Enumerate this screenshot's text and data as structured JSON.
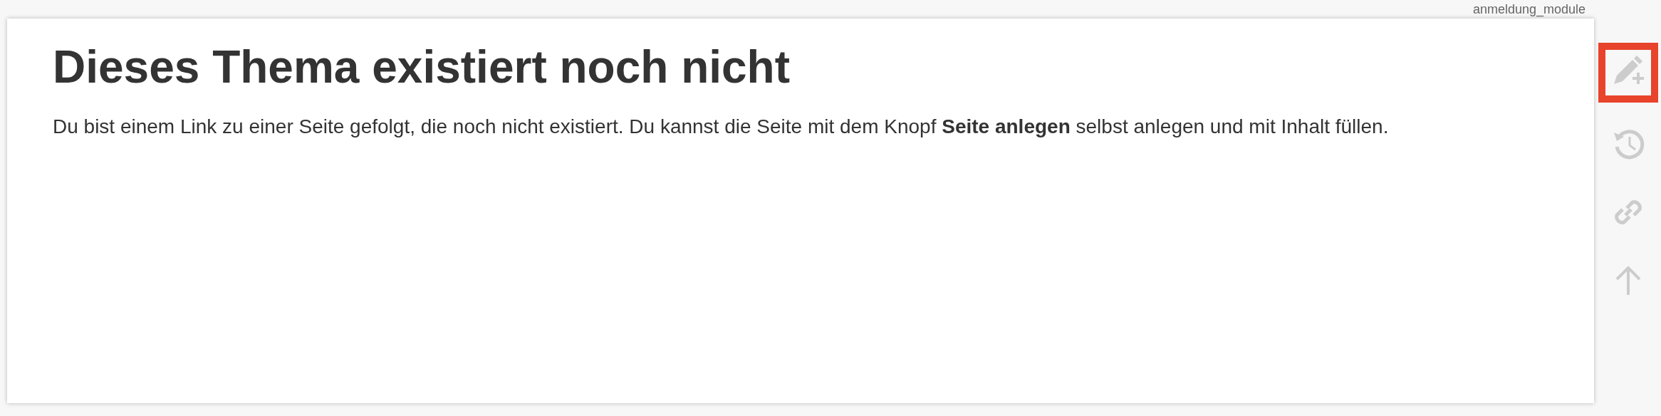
{
  "page_id": "anmeldung_module",
  "heading": "Dieses Thema existiert noch nicht",
  "message": "Du bist einem Link zu einer Seite gefolgt, die noch nicht existiert. Du kannst die Seite mit dem Knopf **Seite anlegen** selbst anlegen und mit Inhalt füllen.",
  "tools": [
    {
      "kind": "create",
      "highlighted": true
    },
    {
      "kind": "history",
      "highlighted": false
    },
    {
      "kind": "backlinks",
      "highlighted": false
    },
    {
      "kind": "top",
      "highlighted": false
    }
  ]
}
